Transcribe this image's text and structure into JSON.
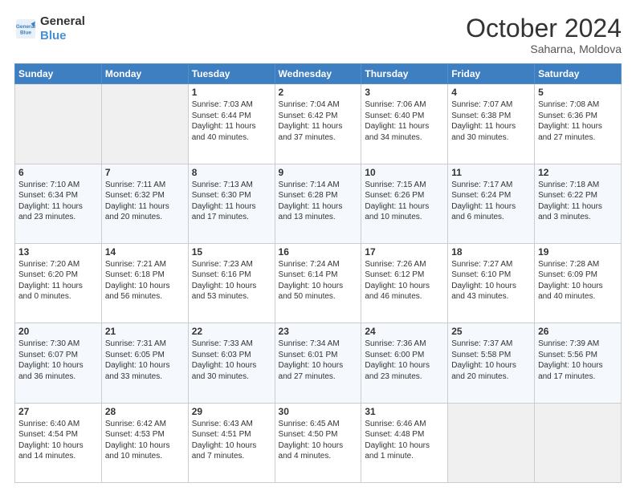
{
  "header": {
    "logo_line1": "General",
    "logo_line2": "Blue",
    "month": "October 2024",
    "location": "Saharna, Moldova"
  },
  "weekdays": [
    "Sunday",
    "Monday",
    "Tuesday",
    "Wednesday",
    "Thursday",
    "Friday",
    "Saturday"
  ],
  "weeks": [
    [
      {
        "day": "",
        "info": ""
      },
      {
        "day": "",
        "info": ""
      },
      {
        "day": "1",
        "info": "Sunrise: 7:03 AM\nSunset: 6:44 PM\nDaylight: 11 hours and 40 minutes."
      },
      {
        "day": "2",
        "info": "Sunrise: 7:04 AM\nSunset: 6:42 PM\nDaylight: 11 hours and 37 minutes."
      },
      {
        "day": "3",
        "info": "Sunrise: 7:06 AM\nSunset: 6:40 PM\nDaylight: 11 hours and 34 minutes."
      },
      {
        "day": "4",
        "info": "Sunrise: 7:07 AM\nSunset: 6:38 PM\nDaylight: 11 hours and 30 minutes."
      },
      {
        "day": "5",
        "info": "Sunrise: 7:08 AM\nSunset: 6:36 PM\nDaylight: 11 hours and 27 minutes."
      }
    ],
    [
      {
        "day": "6",
        "info": "Sunrise: 7:10 AM\nSunset: 6:34 PM\nDaylight: 11 hours and 23 minutes."
      },
      {
        "day": "7",
        "info": "Sunrise: 7:11 AM\nSunset: 6:32 PM\nDaylight: 11 hours and 20 minutes."
      },
      {
        "day": "8",
        "info": "Sunrise: 7:13 AM\nSunset: 6:30 PM\nDaylight: 11 hours and 17 minutes."
      },
      {
        "day": "9",
        "info": "Sunrise: 7:14 AM\nSunset: 6:28 PM\nDaylight: 11 hours and 13 minutes."
      },
      {
        "day": "10",
        "info": "Sunrise: 7:15 AM\nSunset: 6:26 PM\nDaylight: 11 hours and 10 minutes."
      },
      {
        "day": "11",
        "info": "Sunrise: 7:17 AM\nSunset: 6:24 PM\nDaylight: 11 hours and 6 minutes."
      },
      {
        "day": "12",
        "info": "Sunrise: 7:18 AM\nSunset: 6:22 PM\nDaylight: 11 hours and 3 minutes."
      }
    ],
    [
      {
        "day": "13",
        "info": "Sunrise: 7:20 AM\nSunset: 6:20 PM\nDaylight: 11 hours and 0 minutes."
      },
      {
        "day": "14",
        "info": "Sunrise: 7:21 AM\nSunset: 6:18 PM\nDaylight: 10 hours and 56 minutes."
      },
      {
        "day": "15",
        "info": "Sunrise: 7:23 AM\nSunset: 6:16 PM\nDaylight: 10 hours and 53 minutes."
      },
      {
        "day": "16",
        "info": "Sunrise: 7:24 AM\nSunset: 6:14 PM\nDaylight: 10 hours and 50 minutes."
      },
      {
        "day": "17",
        "info": "Sunrise: 7:26 AM\nSunset: 6:12 PM\nDaylight: 10 hours and 46 minutes."
      },
      {
        "day": "18",
        "info": "Sunrise: 7:27 AM\nSunset: 6:10 PM\nDaylight: 10 hours and 43 minutes."
      },
      {
        "day": "19",
        "info": "Sunrise: 7:28 AM\nSunset: 6:09 PM\nDaylight: 10 hours and 40 minutes."
      }
    ],
    [
      {
        "day": "20",
        "info": "Sunrise: 7:30 AM\nSunset: 6:07 PM\nDaylight: 10 hours and 36 minutes."
      },
      {
        "day": "21",
        "info": "Sunrise: 7:31 AM\nSunset: 6:05 PM\nDaylight: 10 hours and 33 minutes."
      },
      {
        "day": "22",
        "info": "Sunrise: 7:33 AM\nSunset: 6:03 PM\nDaylight: 10 hours and 30 minutes."
      },
      {
        "day": "23",
        "info": "Sunrise: 7:34 AM\nSunset: 6:01 PM\nDaylight: 10 hours and 27 minutes."
      },
      {
        "day": "24",
        "info": "Sunrise: 7:36 AM\nSunset: 6:00 PM\nDaylight: 10 hours and 23 minutes."
      },
      {
        "day": "25",
        "info": "Sunrise: 7:37 AM\nSunset: 5:58 PM\nDaylight: 10 hours and 20 minutes."
      },
      {
        "day": "26",
        "info": "Sunrise: 7:39 AM\nSunset: 5:56 PM\nDaylight: 10 hours and 17 minutes."
      }
    ],
    [
      {
        "day": "27",
        "info": "Sunrise: 6:40 AM\nSunset: 4:54 PM\nDaylight: 10 hours and 14 minutes."
      },
      {
        "day": "28",
        "info": "Sunrise: 6:42 AM\nSunset: 4:53 PM\nDaylight: 10 hours and 10 minutes."
      },
      {
        "day": "29",
        "info": "Sunrise: 6:43 AM\nSunset: 4:51 PM\nDaylight: 10 hours and 7 minutes."
      },
      {
        "day": "30",
        "info": "Sunrise: 6:45 AM\nSunset: 4:50 PM\nDaylight: 10 hours and 4 minutes."
      },
      {
        "day": "31",
        "info": "Sunrise: 6:46 AM\nSunset: 4:48 PM\nDaylight: 10 hours and 1 minute."
      },
      {
        "day": "",
        "info": ""
      },
      {
        "day": "",
        "info": ""
      }
    ]
  ]
}
